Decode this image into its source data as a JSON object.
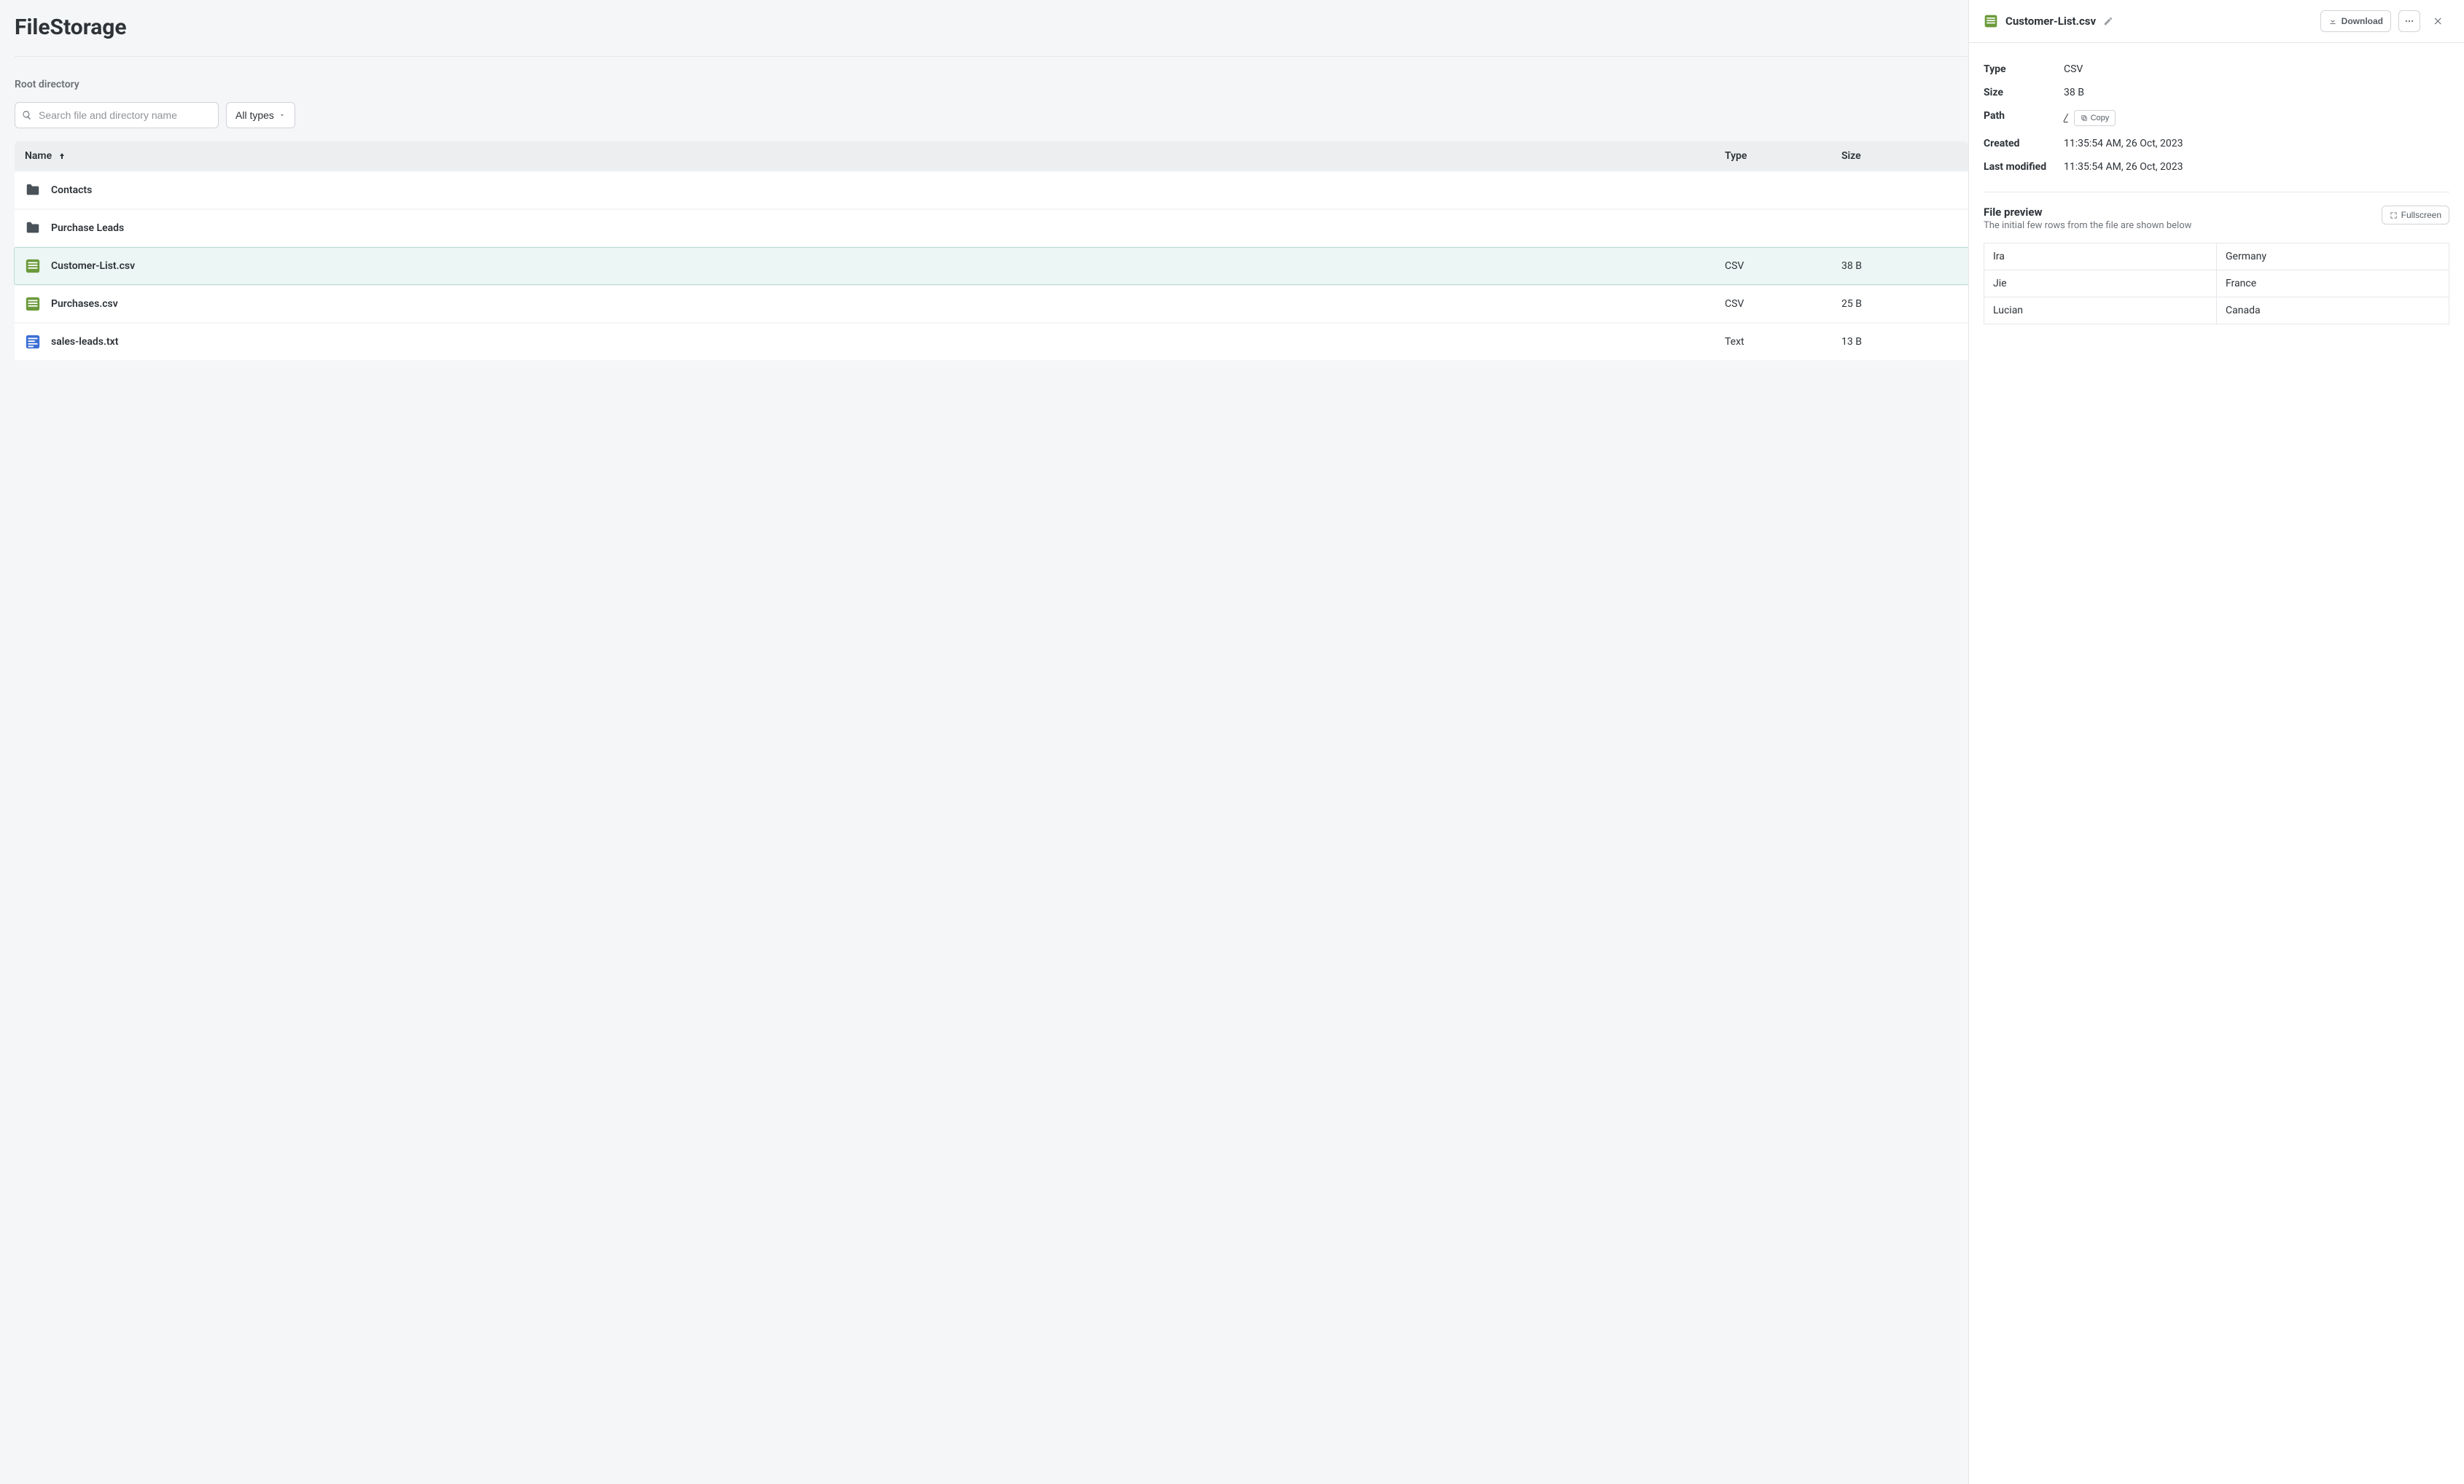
{
  "app": {
    "title": "FileStorage"
  },
  "breadcrumb": {
    "label": "Root directory"
  },
  "toolbar": {
    "search_placeholder": "Search file and directory name",
    "filter_label": "All types"
  },
  "table": {
    "columns": {
      "name": "Name",
      "type": "Type",
      "size": "Size"
    },
    "rows": [
      {
        "name": "Contacts",
        "type": "",
        "size": "",
        "kind": "folder",
        "selected": false
      },
      {
        "name": "Purchase Leads",
        "type": "",
        "size": "",
        "kind": "folder",
        "selected": false
      },
      {
        "name": "Customer-List.csv",
        "type": "CSV",
        "size": "38 B",
        "kind": "csv",
        "selected": true
      },
      {
        "name": "Purchases.csv",
        "type": "CSV",
        "size": "25 B",
        "kind": "csv",
        "selected": false
      },
      {
        "name": "sales-leads.txt",
        "type": "Text",
        "size": "13 B",
        "kind": "txt",
        "selected": false
      }
    ]
  },
  "panel": {
    "filename": "Customer-List.csv",
    "download_label": "Download",
    "meta": {
      "type_label": "Type",
      "type_value": "CSV",
      "size_label": "Size",
      "size_value": "38 B",
      "path_label": "Path",
      "path_value": "/",
      "copy_label": "Copy",
      "created_label": "Created",
      "created_value": "11:35:54 AM, 26 Oct, 2023",
      "modified_label": "Last modified",
      "modified_value": "11:35:54 AM, 26 Oct, 2023"
    },
    "preview": {
      "title": "File preview",
      "subtitle": "The initial few rows from the file are shown below",
      "fullscreen_label": "Fullscreen",
      "rows": [
        [
          "Ira",
          "Germany"
        ],
        [
          "Jie",
          "France"
        ],
        [
          "Lucian",
          "Canada"
        ]
      ]
    }
  }
}
